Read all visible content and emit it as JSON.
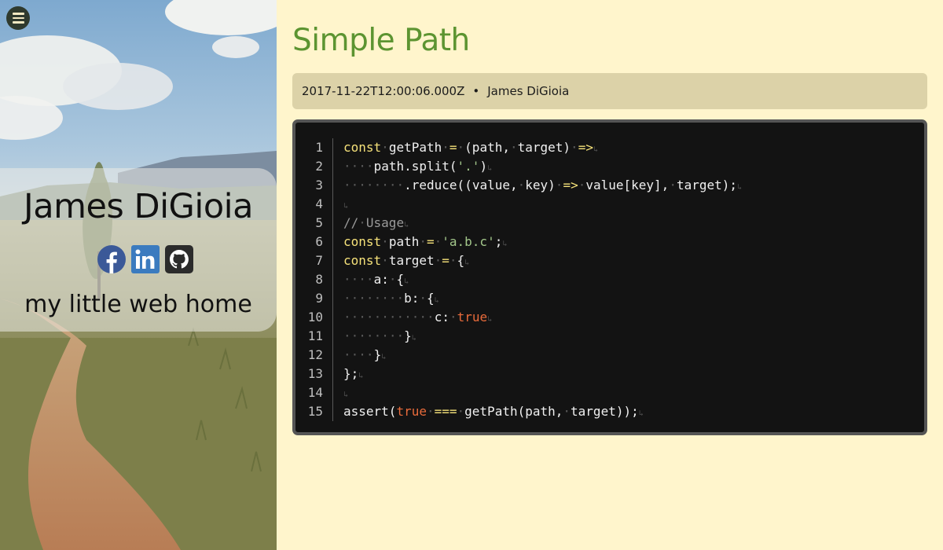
{
  "sidebar": {
    "menu_icon": "hamburger-menu-icon",
    "profile": {
      "name": "James DiGioia",
      "tagline": "my little web home",
      "social": [
        {
          "name": "facebook",
          "icon": "facebook-icon",
          "color": "#3b5998"
        },
        {
          "name": "linkedin",
          "icon": "linkedin-icon",
          "color": "#3b7bbf"
        },
        {
          "name": "github",
          "icon": "github-icon",
          "color": "#2b2b2b"
        }
      ]
    }
  },
  "post": {
    "title": "Simple Path",
    "meta": {
      "date": "2017-11-22T12:00:06.000Z",
      "separator": "•",
      "author": "James DiGioia"
    },
    "code": {
      "line_numbers": [
        "1",
        "2",
        "3",
        "4",
        "5",
        "6",
        "7",
        "8",
        "9",
        "10",
        "11",
        "12",
        "13",
        "14",
        "15"
      ],
      "lines": [
        "const getPath = (path, target) =>",
        "    path.split('.')",
        "        .reduce((value, key) => value[key], target);",
        "",
        "// Usage",
        "const path = 'a.b.c';",
        "const target = {",
        "    a: {",
        "        b: {",
        "            c: true",
        "        }",
        "    }",
        "};",
        "",
        "assert(true === getPath(path, target));"
      ]
    }
  },
  "colors": {
    "page_background": "#fff5cc",
    "title": "#5c9431",
    "meta_background": "#dcd2a8",
    "code_background": "#131313",
    "keyword": "#f6e27a",
    "string": "#a3c78b",
    "boolean": "#e96b3b",
    "comment": "#9a9a9a"
  }
}
